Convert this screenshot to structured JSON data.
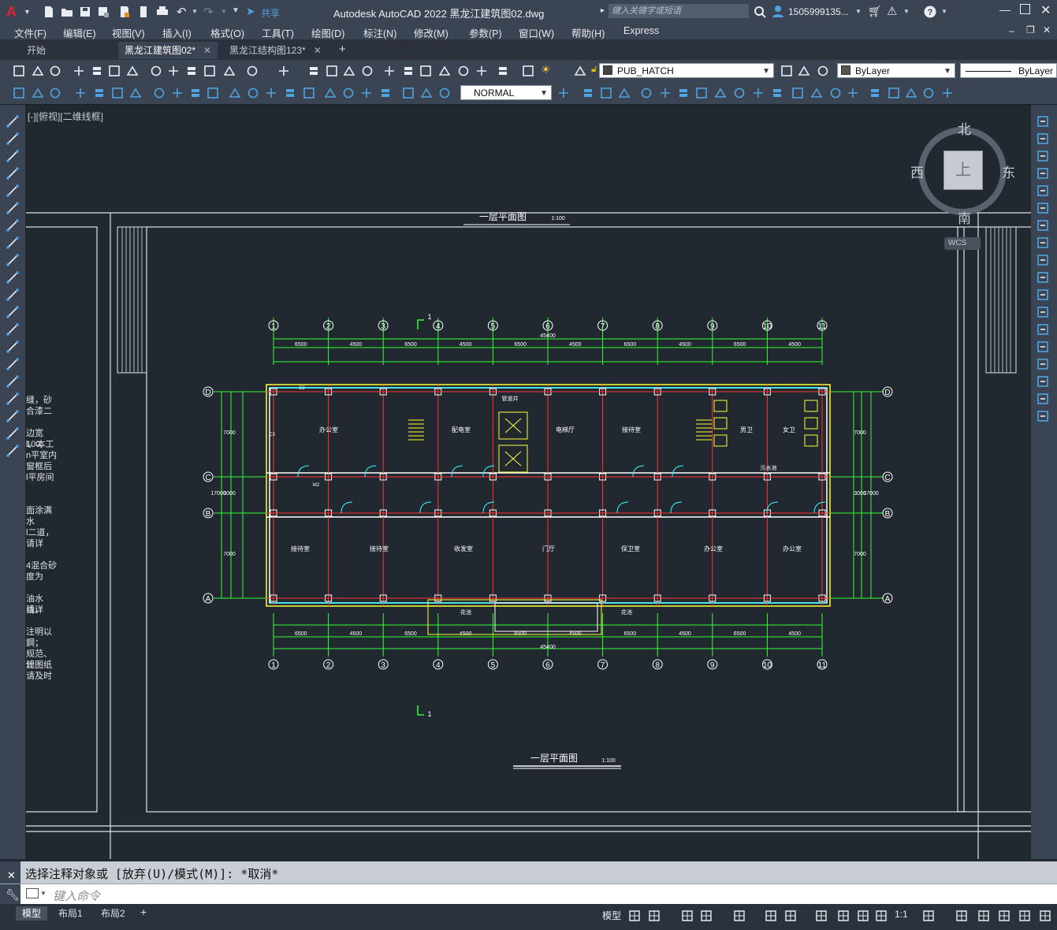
{
  "titlebar": {
    "share_label": "共享",
    "title": "Autodesk AutoCAD 2022    黑龙江建筑图02.dwg",
    "search_placeholder": "键入关键字或短语",
    "user": "1505999135..."
  },
  "menus": [
    "文件(F)",
    "编辑(E)",
    "视图(V)",
    "插入(I)",
    "格式(O)",
    "工具(T)",
    "绘图(D)",
    "标注(N)",
    "修改(M)",
    "参数(P)",
    "窗口(W)",
    "帮助(H)",
    "Express"
  ],
  "tabs": [
    {
      "label": "开始",
      "active": false
    },
    {
      "label": "黑龙江建筑图02*",
      "active": true
    },
    {
      "label": "黑龙江结构图123*",
      "active": false
    }
  ],
  "toolbar": {
    "layer_combo": "PUB_HATCH",
    "color_combo": "ByLayer",
    "linetype_combo": "ByLayer",
    "style_combo": "NORMAL"
  },
  "viewport": {
    "view_label": "[-][俯视][二维线框]",
    "viewcube": {
      "north": "北",
      "south": "南",
      "east": "东",
      "west": "西",
      "top": "上",
      "wcs": "WCS"
    }
  },
  "drawing": {
    "title_top": "一层平面图",
    "title_bottom": "一层平面图",
    "scale": "1:100",
    "section_mark": "1",
    "axes_numbers": [
      "1",
      "2",
      "3",
      "4",
      "5",
      "6",
      "7",
      "8",
      "9",
      "10",
      "11"
    ],
    "axes_letters": [
      "D",
      "C",
      "B",
      "A"
    ],
    "overall_dim": "45400",
    "bay_dims": [
      "6500",
      "4500",
      "6500",
      "4500",
      "6500",
      "4500",
      "6500",
      "4500",
      "6500",
      "4500"
    ],
    "rooms_top": [
      "办公室",
      "配电室",
      "电梯厅",
      "接待室",
      "男卫",
      "女卫"
    ],
    "rooms_bottom": [
      "接待室",
      "接待室",
      "收发室",
      "门厅",
      "保卫室",
      "办公室",
      "办公室"
    ],
    "small_labels": [
      "管道井",
      "花池",
      "花池",
      "污水池",
      "C2",
      "M2",
      "C3"
    ],
    "side_dims": [
      "7000",
      "3000",
      "7000",
      "17000"
    ],
    "notes": [
      "缝，砂",
      "合漆二",
      "",
      "边宽100,",
      "l。本工",
      "n平室内",
      "窗框后",
      "l平房间",
      "",
      "",
      "面涂满水",
      "",
      "l二道，",
      "请详",
      "",
      "4混合砂",
      "度为",
      "",
      "油水线。",
      "请详",
      "",
      "注明以",
      "鋼；",
      "规范、规",
      "计图纸",
      "请及时"
    ]
  },
  "command": {
    "history": "选择注释对象或 [放弃(U)/模式(M)]: *取消*",
    "prompt_placeholder": "键入命令"
  },
  "layout_tabs": [
    "模型",
    "布局1",
    "布局2"
  ],
  "status": {
    "model_label": "模型",
    "scale": "1:1"
  },
  "colors": {
    "bg": "#212830",
    "panel": "#3b4453",
    "axis": "#ff3333",
    "dim": "#33ff33",
    "wall": "#ffffff",
    "yellow": "#ffff33",
    "cyan": "#33ffff"
  }
}
